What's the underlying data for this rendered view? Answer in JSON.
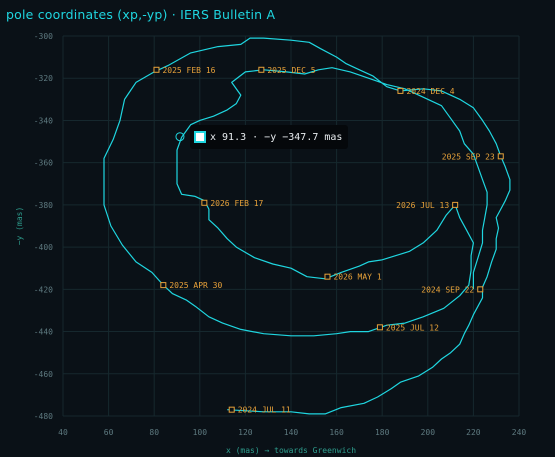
{
  "title": "pole coordinates (xp,-yp) · IERS Bulletin A",
  "colors": {
    "background": "#0a1117",
    "grid": "#16282e",
    "track": "#1fd6e0",
    "date_label": "#e8a23a",
    "tick_text": "#5e7a80",
    "axis_label": "#2e9e8e"
  },
  "tooltip": {
    "text": "x 91.3 · −y −347.7 mas"
  },
  "chart_data": {
    "type": "line",
    "xlabel": "x (mas) → towards Greenwich",
    "ylabel": "−y (mas)",
    "xlim": [
      40,
      240
    ],
    "ylim": [
      -480,
      -300
    ],
    "x_ticks": [
      40,
      60,
      80,
      100,
      120,
      140,
      160,
      180,
      200,
      220,
      240
    ],
    "y_ticks": [
      -300,
      -320,
      -340,
      -360,
      -380,
      -400,
      -420,
      -440,
      -460,
      -480
    ],
    "x_tick_labels": [
      "40",
      "60",
      "80",
      "100",
      "120",
      "140",
      "160",
      "180",
      "200",
      "220",
      "240"
    ],
    "y_tick_labels": [
      "-300",
      "-320",
      "-340",
      "-360",
      "-380",
      "-400",
      "-420",
      "-440",
      "-460",
      "-480"
    ],
    "grid": true,
    "series": [
      {
        "points": [
          [
            112,
            -477
          ],
          [
            128,
            -478
          ],
          [
            140,
            -478
          ],
          [
            148,
            -479
          ],
          [
            155,
            -479
          ],
          [
            162,
            -476
          ],
          [
            172,
            -474
          ],
          [
            178,
            -471
          ],
          [
            184,
            -467
          ],
          [
            188,
            -464
          ],
          [
            196,
            -461
          ],
          [
            202,
            -457
          ],
          [
            206,
            -453
          ],
          [
            210,
            -450
          ],
          [
            214,
            -446
          ],
          [
            216,
            -441
          ],
          [
            218,
            -437
          ],
          [
            220,
            -432
          ],
          [
            222,
            -428
          ],
          [
            224,
            -424
          ],
          [
            224,
            -419
          ],
          [
            226,
            -414
          ],
          [
            228,
            -407
          ],
          [
            230,
            -401
          ],
          [
            230,
            -396
          ],
          [
            231,
            -391
          ],
          [
            230,
            -386
          ],
          [
            232,
            -382
          ],
          [
            234,
            -378
          ],
          [
            236,
            -373
          ],
          [
            236,
            -368
          ],
          [
            234,
            -362
          ],
          [
            232,
            -357
          ],
          [
            230,
            -351
          ],
          [
            227,
            -345
          ],
          [
            224,
            -340
          ],
          [
            220,
            -334
          ],
          [
            214,
            -330
          ],
          [
            206,
            -326
          ],
          [
            198,
            -325
          ],
          [
            188,
            -326
          ],
          [
            182,
            -324
          ],
          [
            176,
            -319
          ],
          [
            170,
            -316
          ],
          [
            164,
            -313
          ],
          [
            160,
            -310
          ],
          [
            153,
            -306
          ],
          [
            148,
            -303
          ],
          [
            140,
            -302
          ],
          [
            128,
            -301
          ],
          [
            122,
            -301
          ],
          [
            118,
            -304
          ],
          [
            108,
            -305
          ],
          [
            96,
            -308
          ],
          [
            86,
            -314
          ],
          [
            80,
            -317
          ],
          [
            72,
            -322
          ],
          [
            67,
            -330
          ],
          [
            65,
            -340
          ],
          [
            62,
            -349
          ],
          [
            58,
            -358
          ],
          [
            58,
            -370
          ],
          [
            58,
            -380
          ],
          [
            61,
            -390
          ],
          [
            66,
            -399
          ],
          [
            72,
            -407
          ],
          [
            79,
            -412
          ],
          [
            84,
            -418
          ],
          [
            88,
            -422
          ],
          [
            94,
            -425
          ],
          [
            98,
            -428
          ],
          [
            104,
            -433
          ],
          [
            110,
            -436
          ],
          [
            118,
            -439
          ],
          [
            128,
            -441
          ],
          [
            140,
            -442
          ],
          [
            150,
            -442
          ],
          [
            160,
            -441
          ],
          [
            166,
            -440
          ],
          [
            174,
            -440
          ],
          [
            182,
            -437
          ],
          [
            190,
            -436
          ],
          [
            198,
            -433
          ],
          [
            207,
            -429
          ],
          [
            214,
            -423
          ],
          [
            218,
            -418
          ],
          [
            219,
            -411
          ],
          [
            219,
            -404
          ],
          [
            220,
            -398
          ],
          [
            217,
            -392
          ],
          [
            214,
            -386
          ],
          [
            212,
            -380
          ],
          [
            208,
            -385
          ],
          [
            204,
            -392
          ],
          [
            198,
            -398
          ],
          [
            192,
            -402
          ],
          [
            186,
            -404
          ],
          [
            180,
            -406
          ],
          [
            174,
            -407
          ],
          [
            170,
            -409
          ],
          [
            162,
            -412
          ],
          [
            155,
            -415
          ],
          [
            147,
            -414
          ],
          [
            140,
            -410
          ],
          [
            132,
            -408
          ],
          [
            124,
            -405
          ],
          [
            116,
            -400
          ],
          [
            112,
            -396
          ],
          [
            108,
            -391
          ],
          [
            104,
            -387
          ],
          [
            104,
            -382
          ],
          [
            102,
            -378
          ],
          [
            98,
            -376
          ],
          [
            92,
            -375
          ],
          [
            90,
            -370
          ],
          [
            90,
            -362
          ],
          [
            90,
            -354
          ],
          [
            92,
            -348
          ],
          [
            96,
            -342
          ],
          [
            100,
            -340
          ],
          [
            106,
            -338
          ],
          [
            112,
            -335
          ],
          [
            116,
            -332
          ],
          [
            118,
            -328
          ],
          [
            114,
            -322
          ],
          [
            120,
            -317
          ],
          [
            128,
            -316
          ],
          [
            138,
            -317
          ],
          [
            146,
            -318
          ],
          [
            152,
            -316
          ],
          [
            158,
            -315
          ],
          [
            166,
            -317
          ],
          [
            174,
            -320
          ],
          [
            182,
            -323
          ],
          [
            190,
            -325
          ],
          [
            198,
            -329
          ],
          [
            206,
            -333
          ],
          [
            210,
            -339
          ],
          [
            214,
            -345
          ],
          [
            216,
            -351
          ],
          [
            220,
            -356
          ],
          [
            222,
            -362
          ],
          [
            224,
            -368
          ],
          [
            226,
            -374
          ],
          [
            226,
            -380
          ],
          [
            225,
            -386
          ],
          [
            224,
            -392
          ],
          [
            224,
            -398
          ],
          [
            222,
            -405
          ],
          [
            220,
            -412
          ],
          [
            220,
            -420
          ]
        ]
      }
    ],
    "highlight_point": {
      "x": 91.3,
      "y": -347.7
    },
    "annotations": [
      {
        "label": "2024 JUL 11",
        "x": 114,
        "y": -477,
        "side": "right"
      },
      {
        "label": "2024 SEP 22",
        "x": 223,
        "y": -420,
        "side": "left"
      },
      {
        "label": "2024 DEC 4",
        "x": 188,
        "y": -326,
        "side": "right"
      },
      {
        "label": "2025 FEB 16",
        "x": 81,
        "y": -316,
        "side": "right"
      },
      {
        "label": "2025 APR 30",
        "x": 84,
        "y": -418,
        "side": "right"
      },
      {
        "label": "2025 JUL 12",
        "x": 179,
        "y": -438,
        "side": "right"
      },
      {
        "label": "2025 SEP 23",
        "x": 232,
        "y": -357,
        "side": "left"
      },
      {
        "label": "2025 DEC 5",
        "x": 127,
        "y": -316,
        "side": "right"
      },
      {
        "label": "2026 FEB 17",
        "x": 102,
        "y": -379,
        "side": "right"
      },
      {
        "label": "2026 MAY 1",
        "x": 156,
        "y": -414,
        "side": "right"
      },
      {
        "label": "2026 JUL 13",
        "x": 212,
        "y": -380,
        "side": "left"
      }
    ]
  }
}
